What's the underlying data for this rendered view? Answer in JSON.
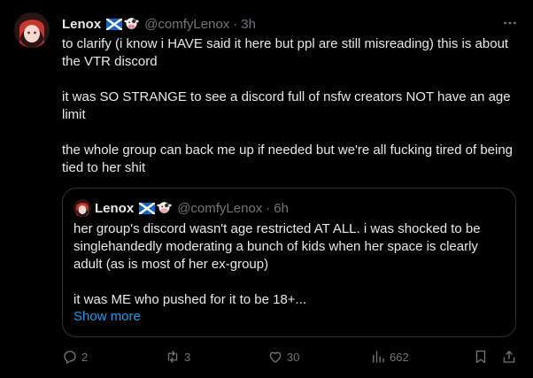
{
  "tweet": {
    "name": "Lenox",
    "handle": "@comfyLenox",
    "time": "3h",
    "paragraphs": [
      "to clarify (i know i HAVE said it here but ppl are still misreading) this is about the VTR discord",
      "it was SO STRANGE to see a discord full of nsfw creators NOT have an age limit",
      "the whole group can back me up if needed but we're all fucking tired of being tied to her shit"
    ],
    "more_label": "···"
  },
  "quote": {
    "name": "Lenox",
    "handle": "@comfyLenox",
    "time": "6h",
    "paragraphs": [
      "her group's discord wasn't age restricted AT ALL. i was shocked to be singlehandedly moderating a bunch of kids when her space is clearly adult (as is most of her ex-group)",
      "it was ME who pushed for it to be 18+..."
    ],
    "show_more": "Show more"
  },
  "actions": {
    "replies": "2",
    "reposts": "3",
    "likes": "30",
    "views": "662"
  },
  "colors": {
    "accent": "#1d9bf0",
    "muted": "#71767b",
    "border": "#2f3336"
  }
}
